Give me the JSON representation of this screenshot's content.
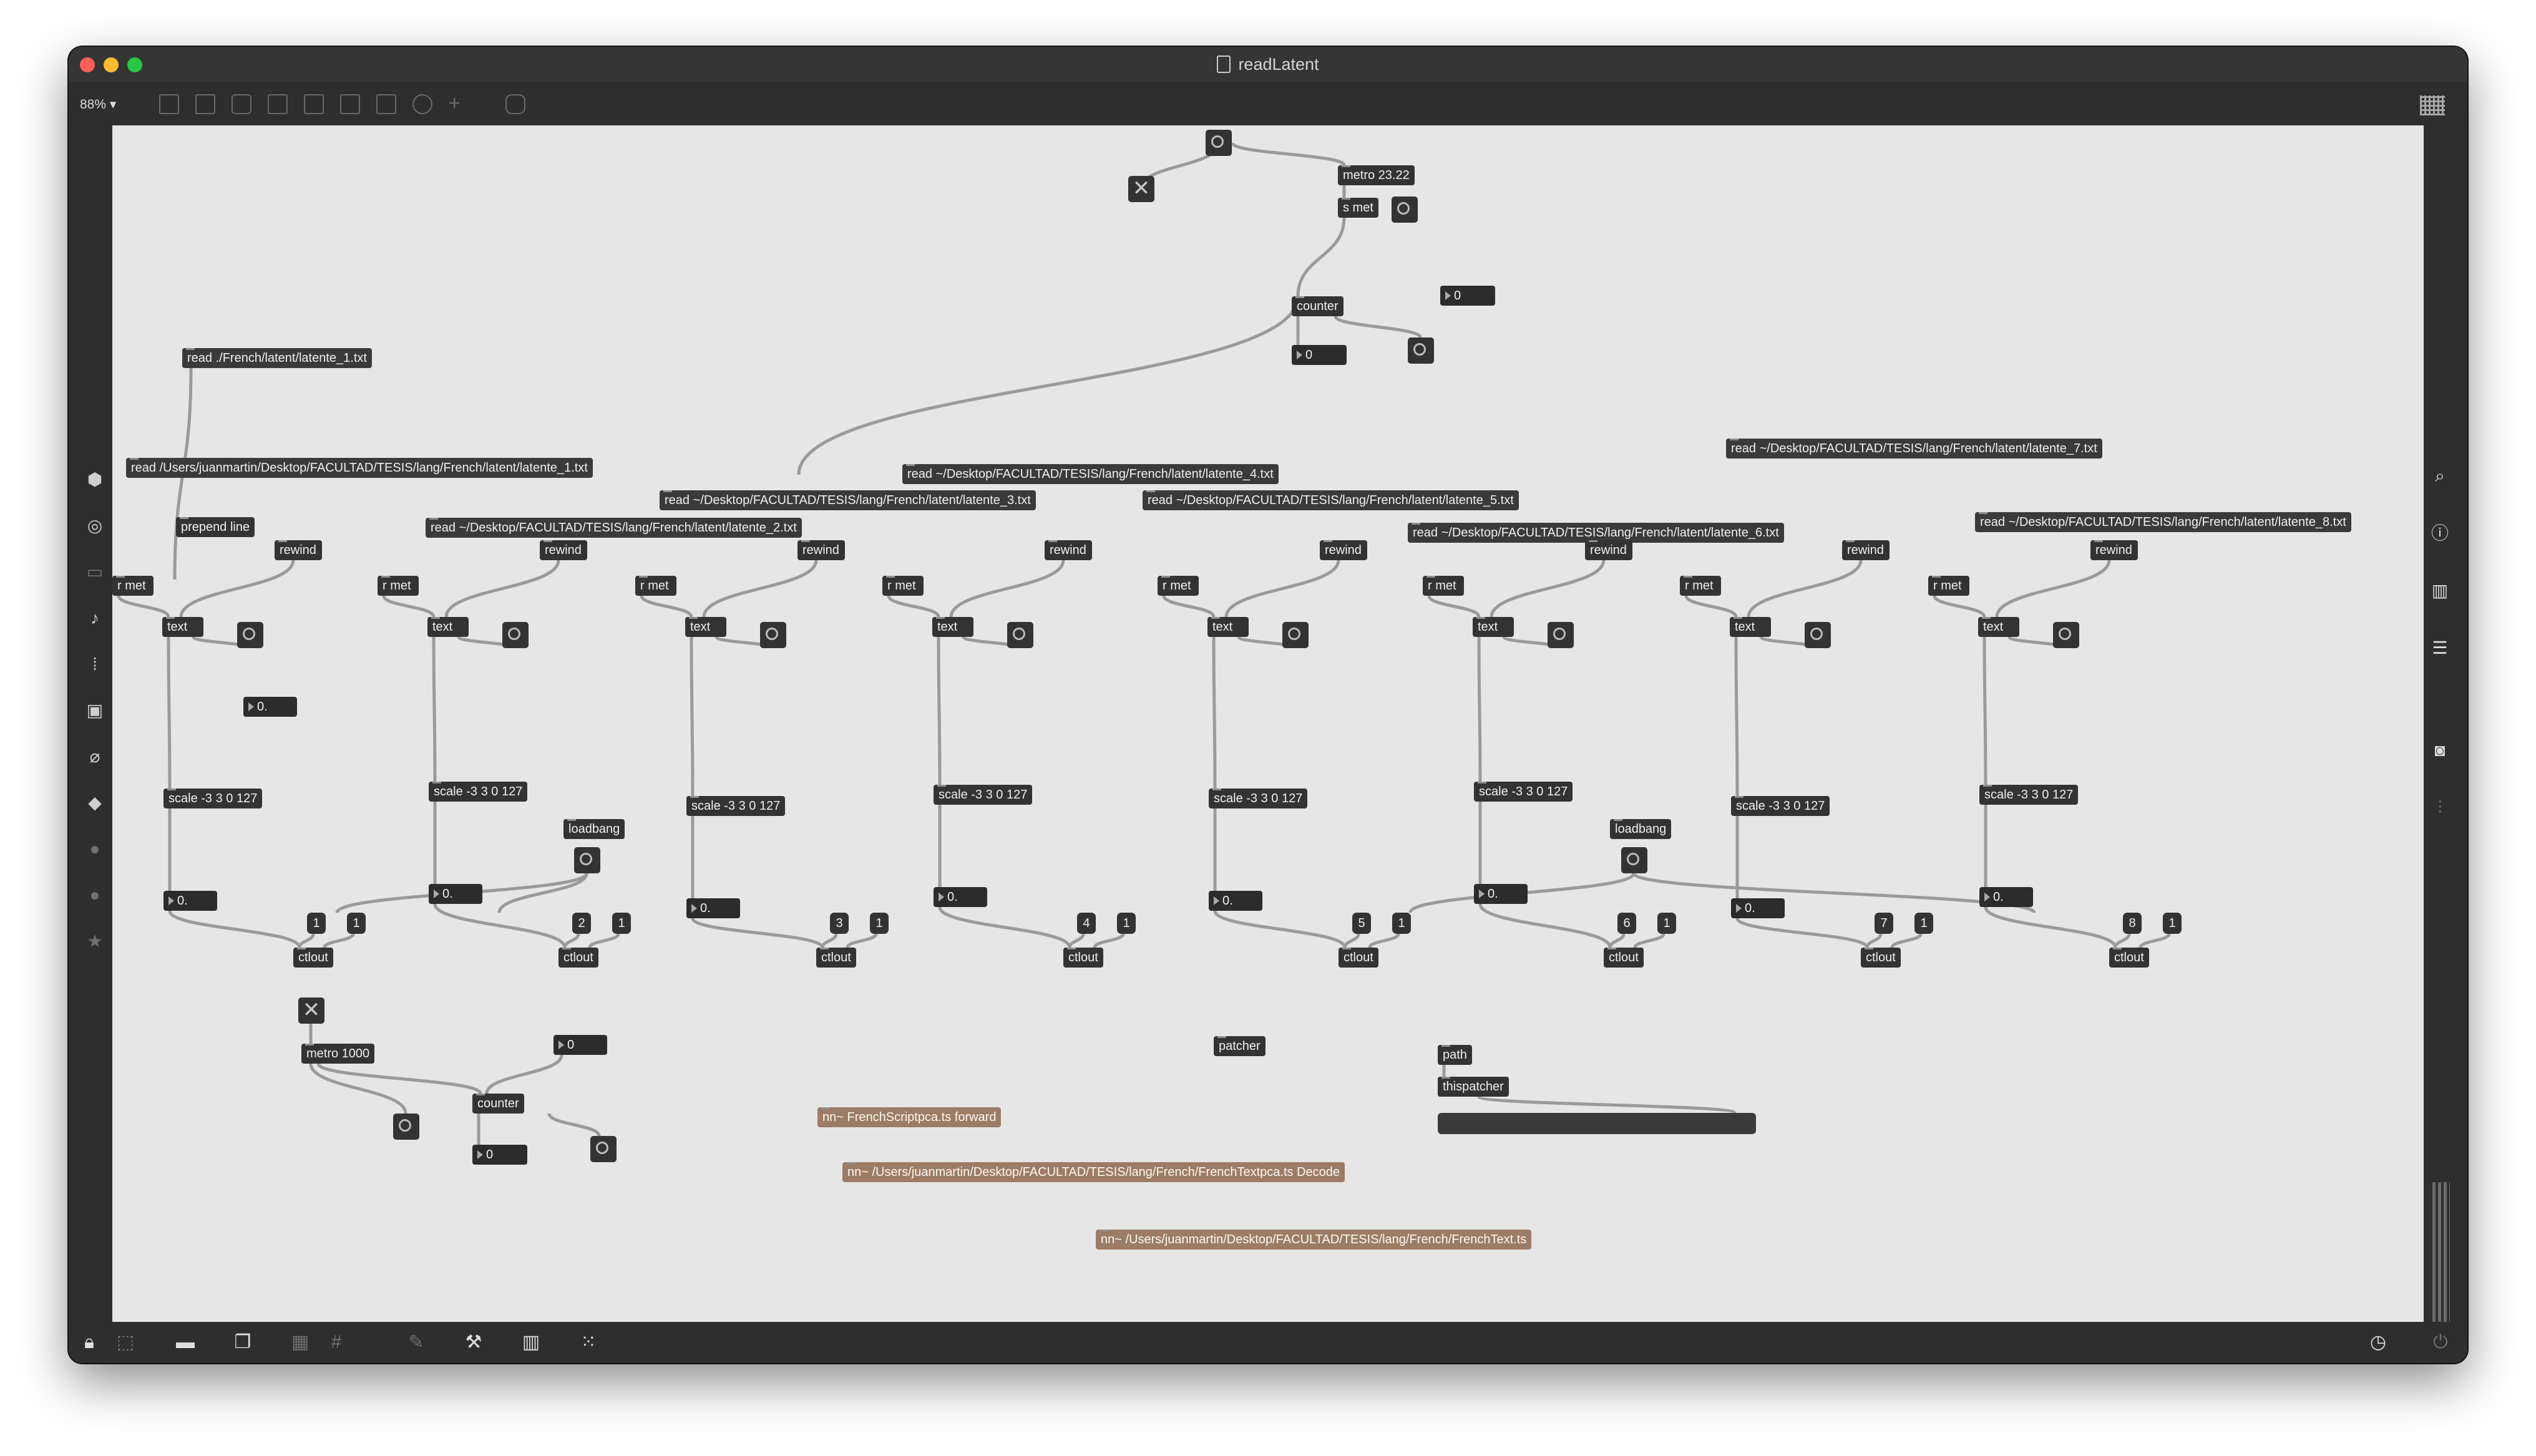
{
  "window": {
    "title": "readLatent"
  },
  "toolbar": {
    "zoom": "88% ▾"
  },
  "objects": {
    "metro_main": "metro 23.22",
    "s_met": "s met",
    "counter_main": "counter",
    "num_top": "0",
    "num_counter_out": "0",
    "read_1": "read ./French/latent/latente_1.txt",
    "read_1b": "read /Users/juanmartin/Desktop/FACULTAD/TESIS/lang/French/latent/latente_1.txt",
    "prepend": "prepend line",
    "read_2": "read ~/Desktop/FACULTAD/TESIS/lang/French/latent/latente_2.txt",
    "read_3": "read ~/Desktop/FACULTAD/TESIS/lang/French/latent/latente_3.txt",
    "read_4": "read ~/Desktop/FACULTAD/TESIS/lang/French/latent/latente_4.txt",
    "read_5": "read ~/Desktop/FACULTAD/TESIS/lang/French/latent/latente_5.txt",
    "read_6": "read ~/Desktop/FACULTAD/TESIS/lang/French/latent/latente_6.txt",
    "read_7": "read ~/Desktop/FACULTAD/TESIS/lang/French/latent/latente_7.txt",
    "read_8": "read ~/Desktop/FACULTAD/TESIS/lang/French/latent/latente_8.txt",
    "rewind": "rewind",
    "rmet": "r met",
    "text": "text",
    "scale": "scale -3 3 0 127",
    "num_float": "0.",
    "loadbang": "loadbang",
    "ctlout": "ctlout",
    "one": "1",
    "ch": [
      "1",
      "2",
      "3",
      "4",
      "5",
      "6",
      "7",
      "8"
    ],
    "metro_1000": "metro 1000",
    "counter2": "counter",
    "num_zero": "0",
    "patcher": "patcher",
    "path": "path",
    "thispatcher": "thispatcher",
    "nn_1": "nn~ FrenchScriptpca.ts forward",
    "nn_2": "nn~ /Users/juanmartin/Desktop/FACULTAD/TESIS/lang/French/FrenchTextpca.ts Decode",
    "nn_3": "nn~ /Users/juanmartin/Desktop/FACULTAD/TESIS/lang/French/FrenchText.ts"
  },
  "icons": {
    "left": [
      "cube-icon",
      "target-icon",
      "film-icon",
      "music-note-icon",
      "sequence-icon",
      "image-icon",
      "paperclip-icon",
      "puzzle-icon",
      "p-icon",
      "b-icon",
      "star-icon"
    ],
    "right": [
      "search-icon",
      "info-icon",
      "columns-icon",
      "list-icon",
      "camera-icon",
      "sliders-icon"
    ],
    "bottom": [
      "lock-icon",
      "presentation-icon",
      "comment-icon",
      "windows-icon",
      "grid-off-icon",
      "pencil-icon",
      "wrench-icon",
      "piano-icon",
      "keypad-icon",
      "clock-icon",
      "power-icon"
    ]
  },
  "colors": {
    "canvas": "#e6e6e6",
    "object": "#333333",
    "nn_object": "#9c7c67",
    "cable": "#9a9a9a"
  }
}
